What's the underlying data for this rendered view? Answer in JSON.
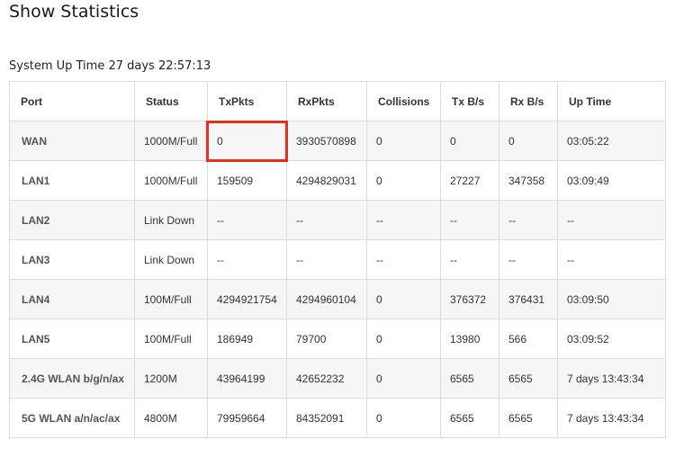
{
  "title": "Show Statistics",
  "uptime": "System Up Time 27 days 22:57:13",
  "columns": [
    "Port",
    "Status",
    "TxPkts",
    "RxPkts",
    "Collisions",
    "Tx B/s",
    "Rx B/s",
    "Up Time"
  ],
  "rows": [
    [
      "WAN",
      "1000M/Full",
      "0",
      "3930570898",
      "0",
      "0",
      "0",
      "03:05:22"
    ],
    [
      "LAN1",
      "1000M/Full",
      "159509",
      "4294829031",
      "0",
      "27227",
      "347358",
      "03:09:49"
    ],
    [
      "LAN2",
      "Link Down",
      "--",
      "--",
      "--",
      "--",
      "--",
      "--"
    ],
    [
      "LAN3",
      "Link Down",
      "--",
      "--",
      "--",
      "--",
      "--",
      "--"
    ],
    [
      "LAN4",
      "100M/Full",
      "4294921754",
      "4294960104",
      "0",
      "376372",
      "376431",
      "03:09:50"
    ],
    [
      "LAN5",
      "100M/Full",
      "186949",
      "79700",
      "0",
      "13980",
      "566",
      "03:09:52"
    ],
    [
      "2.4G WLAN b/g/n/ax",
      "1200M",
      "43964199",
      "42652232",
      "0",
      "6565",
      "6565",
      "7 days 13:43:34"
    ],
    [
      "5G WLAN a/n/ac/ax",
      "4800M",
      "79959664",
      "84352091",
      "0",
      "6565",
      "6565",
      "7 days 13:43:34"
    ]
  ],
  "highlight_color": "#e53020"
}
